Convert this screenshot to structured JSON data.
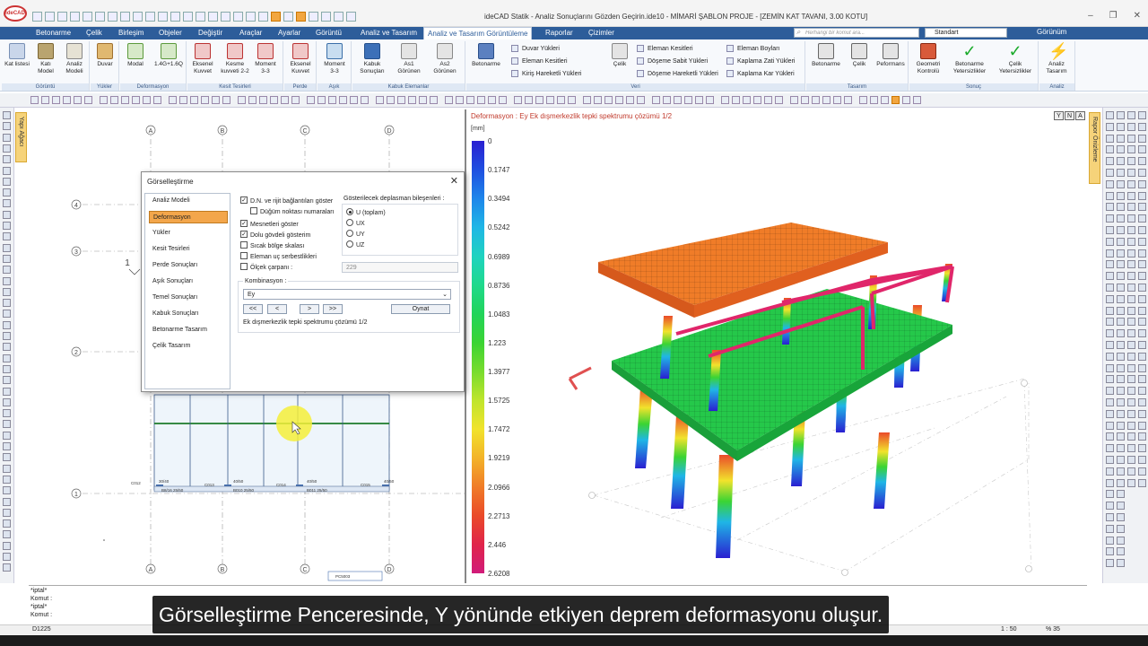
{
  "app": {
    "logo_text": "ideCAD",
    "window_title": "ideCAD Statik - Analiz Sonuçlarını Gözden Geçirin.ide10 - MİMARİ ŞABLON PROJE - [ZEMİN KAT TAVANI,  3.00 KOTU]",
    "window_controls": [
      "–",
      "❐",
      "✕"
    ]
  },
  "menu_tabs": [
    {
      "label": "Betonarme"
    },
    {
      "label": "Çelik"
    },
    {
      "label": "Birleşim"
    },
    {
      "label": "Objeler"
    },
    {
      "label": "Değiştir"
    },
    {
      "label": "Araçlar"
    },
    {
      "label": "Ayarlar"
    },
    {
      "label": "Görüntü"
    },
    {
      "label": "Analiz ve Tasarım"
    },
    {
      "label": "Analiz ve Tasarım Görüntüleme"
    },
    {
      "label": "Raporlar"
    },
    {
      "label": "Çizimler"
    }
  ],
  "search": {
    "placeholder": "Herhangi bir komut ara..."
  },
  "standard_select": "Standart",
  "gorunum_label": "Görünüm",
  "ribbon": {
    "groups": [
      {
        "label": "Görüntü"
      },
      {
        "label": "Yükler"
      },
      {
        "label": "Deformasyon"
      },
      {
        "label": "Kesit Tesirleri"
      },
      {
        "label": "Perde"
      },
      {
        "label": "Aşık"
      },
      {
        "label": "Kabuk Elemanlar"
      },
      {
        "label": "Veri"
      },
      {
        "label": "Tasarım"
      },
      {
        "label": "Sonuç"
      },
      {
        "label": "Analiz"
      }
    ],
    "buttons": [
      {
        "label": "Kat listesi"
      },
      {
        "label": "Katı Model"
      },
      {
        "label": "Analiz Modeli"
      },
      {
        "label": "Duvar"
      },
      {
        "label": "Modal"
      },
      {
        "label": "1.4G+1.6Q"
      },
      {
        "label": "Eksenel Kuvvet"
      },
      {
        "label": "Kesme kuvveti 2-2"
      },
      {
        "label": "Moment 3-3"
      },
      {
        "label": "Eksenel Kuvvet"
      },
      {
        "label": "Moment 3-3"
      },
      {
        "label": "Kabuk Sonuçları"
      },
      {
        "label": "As1 Görünen"
      },
      {
        "label": "As2 Görünen"
      },
      {
        "label": "Betonarme"
      },
      {
        "label": "Çelik"
      },
      {
        "label": "Betonarme"
      },
      {
        "label": "Çelik"
      },
      {
        "label": "Peformans"
      },
      {
        "label": "Geometri Kontrolü"
      },
      {
        "label": "Betonarme Yetersizlikler"
      },
      {
        "label": "Çelik Yetersizlikler"
      },
      {
        "label": "Analiz Tasarım"
      }
    ],
    "data_items": [
      {
        "label": "Duvar Yükleri"
      },
      {
        "label": "Eleman Kesitleri"
      },
      {
        "label": "Kiriş Hareketli Yükleri"
      },
      {
        "label": "Eleman Kesitleri"
      },
      {
        "label": "Döşeme Sabit Yükleri"
      },
      {
        "label": "Döşeme Hareketli Yükleri"
      },
      {
        "label": "Eleman Boyları"
      },
      {
        "label": "Kaplama Zati Yükleri"
      },
      {
        "label": "Kaplama Kar Yükleri"
      }
    ]
  },
  "left_panel_tab": "Yapı Ağacı",
  "right_panel_tab": "Rapor Önizleme",
  "plan": {
    "axes_top": [
      "A",
      "B",
      "C",
      "D"
    ],
    "axes_left": [
      "4",
      "3",
      "2",
      "1"
    ],
    "section_mark": "1",
    "labels": [
      "C012",
      "C013",
      "C014",
      "C015",
      "B8/16 25/50",
      "B010 25/50",
      "B011 25/50",
      "30/40",
      "40/50",
      "40/50",
      "40/50",
      "PC5003"
    ]
  },
  "view3d": {
    "title": "Deformasyon : Ey    Ek dışmerkezlik tepki spektrumu çözümü 1/2",
    "unit": "[mm]",
    "legend_values": [
      "0",
      "0.1747",
      "0.3494",
      "0.5242",
      "0.6989",
      "0.8736",
      "1.0483",
      "1.223",
      "1.3977",
      "1.5725",
      "1.7472",
      "1.9219",
      "2.0966",
      "2.2713",
      "2.446",
      "2.6208"
    ],
    "legend_colors": [
      "#2a1fd1",
      "#1f4fe0",
      "#1e86ea",
      "#1fb6e6",
      "#1fd3c0",
      "#1fd98c",
      "#22d45a",
      "#3bd433",
      "#78dc2e",
      "#bfe52c",
      "#f1e32c",
      "#f3b329",
      "#f07c28",
      "#ea4a29",
      "#e0244a",
      "#d11b7a"
    ],
    "view_buttons": [
      "Y",
      "N",
      "A"
    ]
  },
  "dialog": {
    "title": "Görselleştirme",
    "close": "✕",
    "nav": [
      {
        "label": "Analiz Modeli",
        "active": false
      },
      {
        "label": "Deformasyon",
        "active": true
      },
      {
        "label": "Yükler",
        "active": false
      },
      {
        "label": "Kesit Tesirleri",
        "active": false
      },
      {
        "label": "Perde Sonuçları",
        "active": false
      },
      {
        "label": "Aşık Sonuçları",
        "active": false
      },
      {
        "label": "Temel Sonuçları",
        "active": false
      },
      {
        "label": "Kabuk Sonuçları",
        "active": false
      },
      {
        "label": "Betonarme Tasarım",
        "active": false
      },
      {
        "label": "Çelik Tasarım",
        "active": false
      }
    ],
    "checkboxes": [
      {
        "label": "D.N. ve rijit bağlantıları göster",
        "checked": true
      },
      {
        "label": "Düğüm noktası numaraları",
        "checked": false
      },
      {
        "label": "Mesnetleri göster",
        "checked": true
      },
      {
        "label": "Dolu gövdeli gösterim",
        "checked": true
      },
      {
        "label": "Sıcak bölge skalası",
        "checked": false
      },
      {
        "label": "Eleman uç serbestlikleri",
        "checked": false
      },
      {
        "label": "Ölçek çarpanı :",
        "checked": false
      }
    ],
    "scale_value": "229",
    "displacement_label": "Gösterilecek deplasman bileşenleri :",
    "radios": [
      {
        "label": "U (toplam)",
        "checked": true
      },
      {
        "label": "UX",
        "checked": false
      },
      {
        "label": "UY",
        "checked": false
      },
      {
        "label": "UZ",
        "checked": false
      }
    ],
    "combination_label": "Kombinasyon :",
    "combination_value": "Ey",
    "nav_buttons": [
      "<<",
      "<",
      ">",
      ">>"
    ],
    "play_button": "Oynat",
    "status_text": "Ek dışmerkezlik tepki spektrumu çözümü 1/2"
  },
  "command": {
    "lines": [
      "*iptal*",
      "Komut :",
      "*iptal*",
      "Komut :"
    ]
  },
  "status": {
    "left": "D1225",
    "scale": "1 : 50",
    "zoom": "% 35"
  },
  "subtitle": "Görselleştirme Penceresinde, Y yönünde etkiyen deprem deformasyonu oluşur."
}
